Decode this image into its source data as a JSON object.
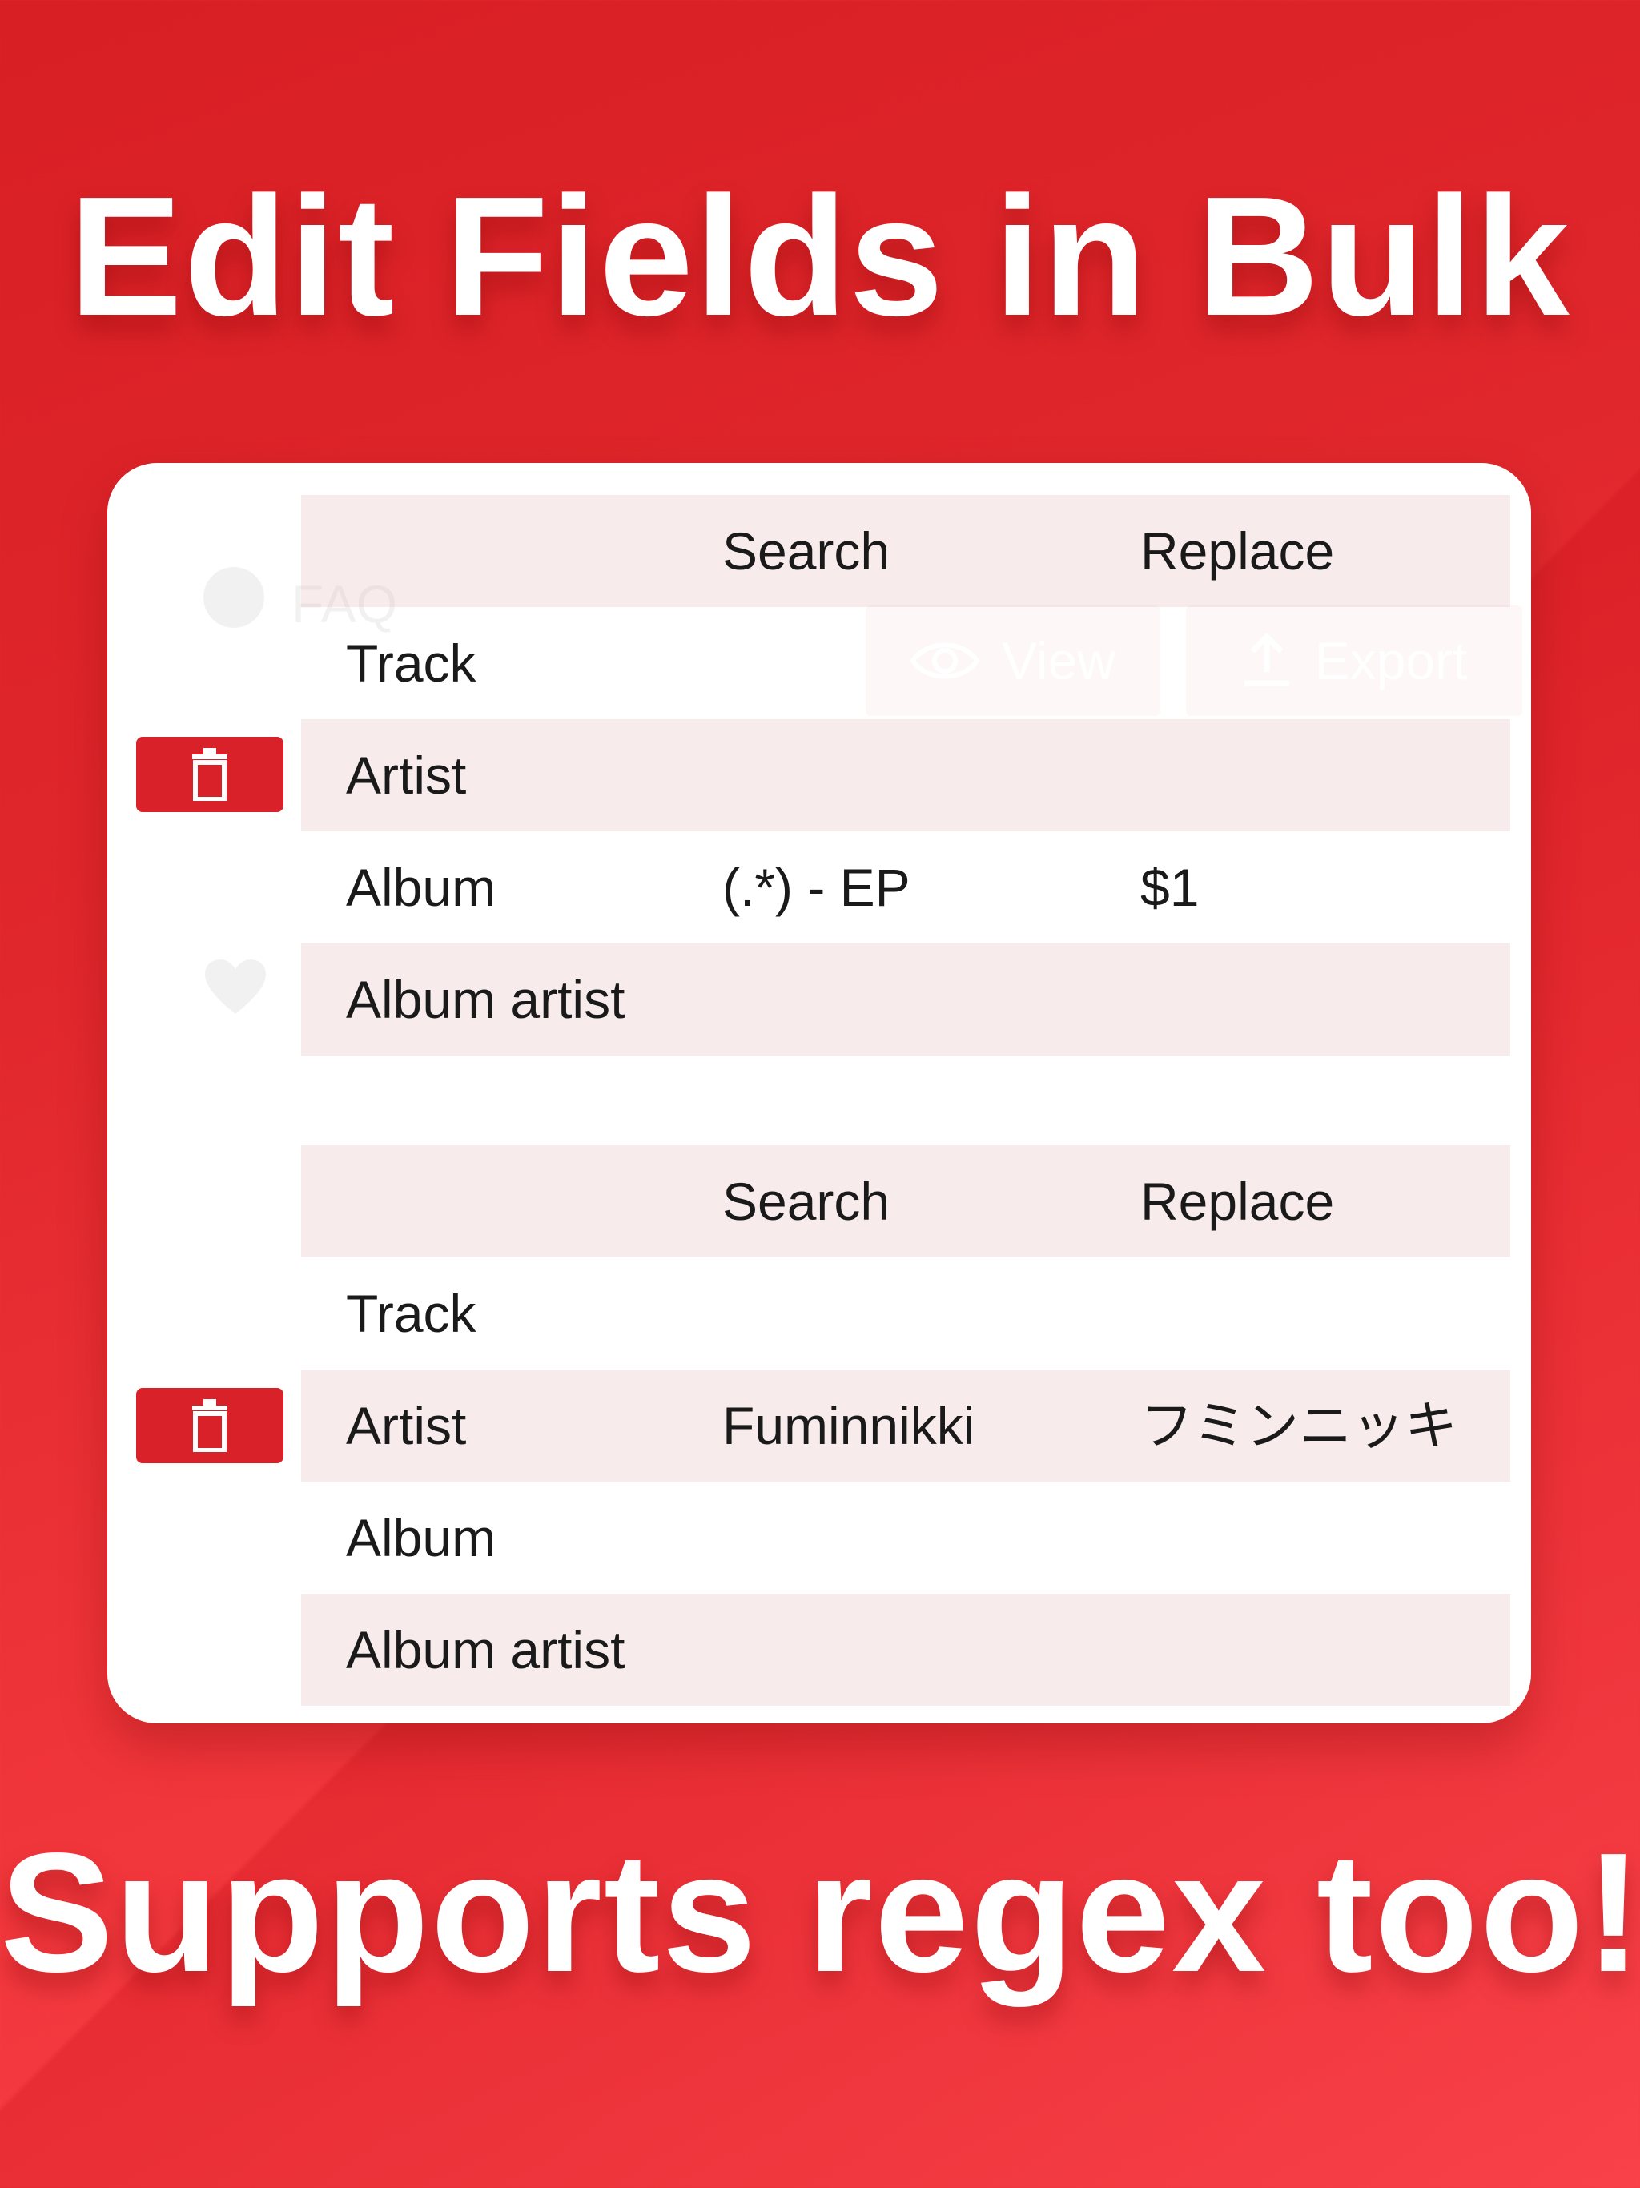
{
  "headline_top": "Edit Fields in Bulk",
  "headline_bottom": "Supports regex too!",
  "background_ui": {
    "faq_label": "FAQ",
    "view_label": "View",
    "export_label": "Export"
  },
  "tables": [
    {
      "header": {
        "search": "Search",
        "replace": "Replace"
      },
      "rows": [
        {
          "field": "Track",
          "search": "",
          "replace": ""
        },
        {
          "field": "Artist",
          "search": "",
          "replace": ""
        },
        {
          "field": "Album",
          "search": "(.*) - EP",
          "replace": "$1"
        },
        {
          "field": "Album artist",
          "search": "",
          "replace": ""
        }
      ]
    },
    {
      "header": {
        "search": "Search",
        "replace": "Replace"
      },
      "rows": [
        {
          "field": "Track",
          "search": "",
          "replace": ""
        },
        {
          "field": "Artist",
          "search": "Fuminnikki",
          "replace": "フミンニッキ"
        },
        {
          "field": "Album",
          "search": "",
          "replace": ""
        },
        {
          "field": "Album artist",
          "search": "",
          "replace": ""
        }
      ]
    }
  ],
  "icons": {
    "delete": "trash-icon",
    "faq": "question-circle-icon",
    "view": "eye-icon",
    "export": "share-upload-icon",
    "favorite": "heart-icon"
  },
  "colors": {
    "accent": "#d82128",
    "row_tint": "#f9eaea",
    "background_top": "#d81f24",
    "background_bottom": "#fb444c"
  }
}
